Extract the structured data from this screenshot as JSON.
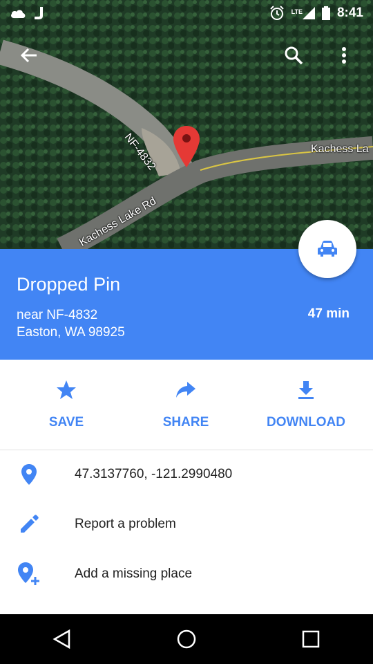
{
  "status_bar": {
    "time": "8:41",
    "network": "LTE",
    "icons": [
      "cloud-icon",
      "j-icon",
      "alarm-icon",
      "signal-icon",
      "battery-icon"
    ]
  },
  "map": {
    "road_labels": [
      "NF-4832",
      "Kachess Lake Rd",
      "Kachess La"
    ],
    "pin_color": "#e53935"
  },
  "toolbar": {
    "back_icon": "back-arrow-icon",
    "search_icon": "search-icon",
    "menu_icon": "more-vert-icon"
  },
  "place": {
    "title": "Dropped Pin",
    "address_line1": "near NF-4832",
    "address_line2": "Easton, WA 98925",
    "eta": "47 min",
    "accent": "#4285f4"
  },
  "actions": [
    {
      "label": "SAVE",
      "icon": "star-icon"
    },
    {
      "label": "SHARE",
      "icon": "share-icon"
    },
    {
      "label": "DOWNLOAD",
      "icon": "download-icon"
    }
  ],
  "details": [
    {
      "text": "47.3137760, -121.2990480",
      "icon": "location-pin-icon"
    },
    {
      "text": "Report a problem",
      "icon": "pencil-icon"
    },
    {
      "text": "Add a missing place",
      "icon": "add-place-icon"
    }
  ],
  "nav_bar": [
    "back-triangle-icon",
    "home-circle-icon",
    "recents-square-icon"
  ]
}
